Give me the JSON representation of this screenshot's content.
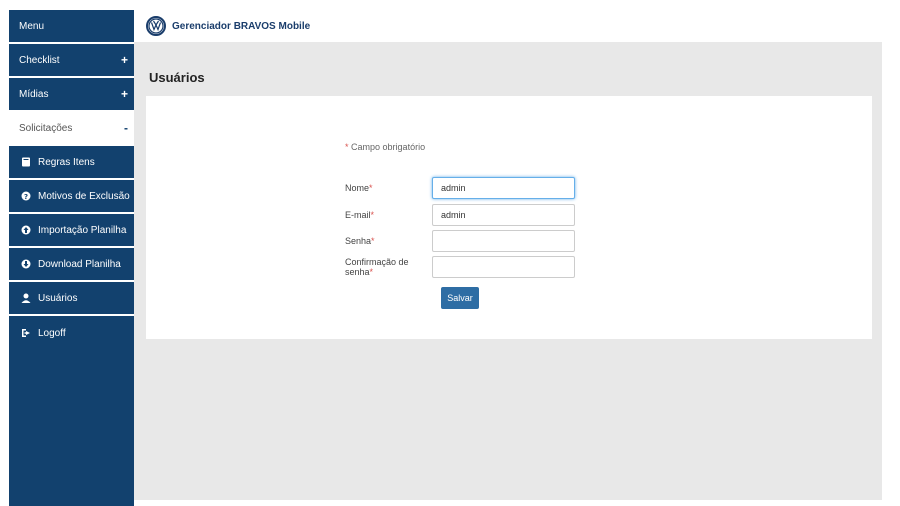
{
  "header": {
    "app_title": "Gerenciador BRAVOS Mobile",
    "logo_icon": "vw-logo"
  },
  "sidebar": {
    "items": [
      {
        "label": "Menu"
      },
      {
        "label": "Checklist",
        "toggle": "+"
      },
      {
        "label": "Mídias",
        "toggle": "+"
      },
      {
        "label": "Solicitações",
        "toggle": "-"
      },
      {
        "label": "Regras Itens",
        "icon": "book-icon"
      },
      {
        "label": "Motivos de Exclusão",
        "icon": "question-circle-icon"
      },
      {
        "label": "Importação Planilha",
        "icon": "upload-circle-icon"
      },
      {
        "label": "Download Planilha",
        "icon": "download-circle-icon"
      },
      {
        "label": "Usuários",
        "icon": "user-icon"
      },
      {
        "label": "Logoff",
        "icon": "logout-icon"
      }
    ]
  },
  "page": {
    "title": "Usuários"
  },
  "form": {
    "required_marker": "*",
    "required_note": "Campo obrigatório",
    "fields": [
      {
        "label": "Nome",
        "value": "admin"
      },
      {
        "label": "E-mail",
        "value": "admin"
      },
      {
        "label": "Senha",
        "value": ""
      },
      {
        "label": "Confirmação de senha",
        "value": ""
      }
    ],
    "save_label": "Salvar"
  },
  "colors": {
    "sidebar_bg": "#12416e",
    "accent": "#2e6da4",
    "required": "#d9534f",
    "content_bg": "#e8e8e8"
  }
}
